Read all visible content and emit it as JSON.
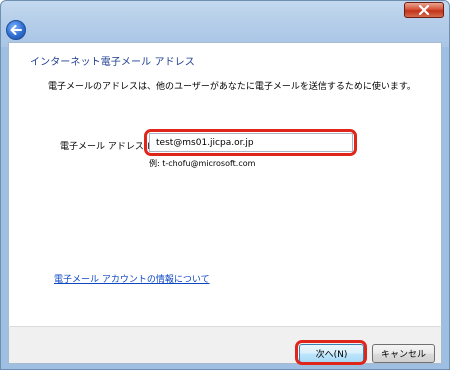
{
  "window": {
    "close_icon": "close-icon"
  },
  "header": {
    "back_icon": "back-arrow-icon"
  },
  "page": {
    "title": "インターネット電子メール アドレス",
    "description": "電子メールのアドレスは、他のユーザーがあなたに電子メールを送信するために使います。",
    "field_label": "電子メール アドレス(E):",
    "email_value": "test@ms01.jicpa.or.jp",
    "example": "例: t-chofu@microsoft.com",
    "help_link": "電子メール アカウントの情報について"
  },
  "buttons": {
    "next_label": "次へ(N)",
    "cancel_label": "キャンセル"
  },
  "colors": {
    "title": "#1e3f8f",
    "link": "#0d47c4",
    "highlight": "#e0251b",
    "close": "#c3321b"
  }
}
